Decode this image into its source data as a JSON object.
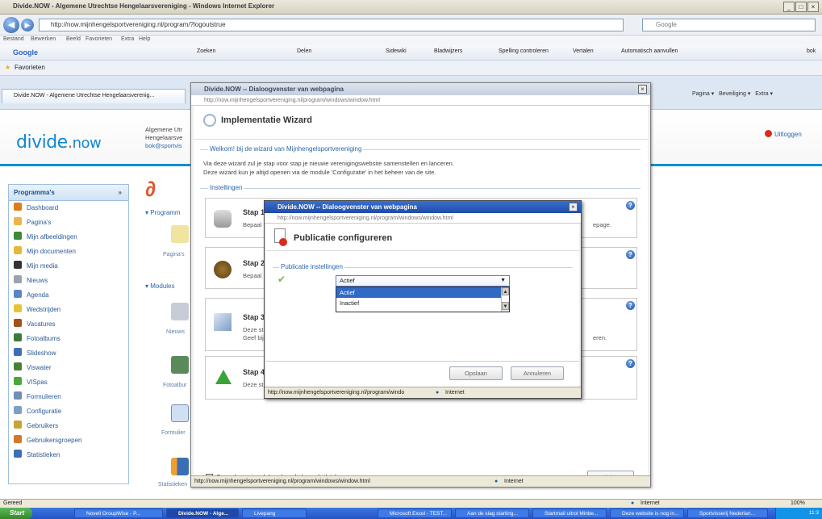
{
  "browser": {
    "title": "Divide.NOW - Algemene Utrechtse Hengelaarsvereniging - Windows Internet Explorer",
    "url": "http://now.mijnhengelsportvereniging.nl/program/?logoutstrue",
    "search_placeholder": "Google",
    "menu": [
      "Bestand",
      "Bewerken",
      "Beeld",
      "Favorieten",
      "Extra",
      "Help"
    ],
    "toolbar": [
      "Google",
      "Zoeken",
      "Delen",
      "Sidewiki",
      "Bladwijzers",
      "Spelling controleren",
      "Vertalen",
      "Automatisch aanvullen",
      "bok"
    ],
    "favorites_label": "Favorieten",
    "tab_label": "Divide.NOW - Algemene Utrechtse Hengelaarsverenig...",
    "command_bar": [
      "Pagina",
      "Beveiliging",
      "Extra"
    ],
    "status_left": "Gereed",
    "status_zone": "Internet",
    "status_zoom": "100%"
  },
  "site": {
    "logo_main": "divide",
    "logo_dot": ".",
    "logo_now": "now",
    "org_line1": "Algemene Utr",
    "org_line2": "Hengelaarsve",
    "org_line3": "bok@sportvis",
    "logout": "Uitloggen"
  },
  "sidebar": {
    "title": "Programma's",
    "items": [
      {
        "label": "Dashboard",
        "color": "#e07b1a"
      },
      {
        "label": "Pagina's",
        "color": "#e8b64a"
      },
      {
        "label": "Mijn afbeeldingen",
        "color": "#3d8a3a"
      },
      {
        "label": "Mijn documenten",
        "color": "#e5b83c"
      },
      {
        "label": "Mijn media",
        "color": "#333333"
      },
      {
        "label": "Nieuws",
        "color": "#9aa3b0"
      },
      {
        "label": "Agenda",
        "color": "#5c85c5"
      },
      {
        "label": "Wedstrijden",
        "color": "#e7c33b"
      },
      {
        "label": "Vacatures",
        "color": "#a0521d"
      },
      {
        "label": "Fotoalbums",
        "color": "#3d7a3a"
      },
      {
        "label": "Slideshow",
        "color": "#3a6fb5"
      },
      {
        "label": "Viswater",
        "color": "#4a7f3a"
      },
      {
        "label": "VISpas",
        "color": "#4aa83a"
      },
      {
        "label": "Formulieren",
        "color": "#6f8fb5"
      },
      {
        "label": "Configuratie",
        "color": "#7aa0c8"
      },
      {
        "label": "Gebruikers",
        "color": "#c8a23a"
      },
      {
        "label": "Gebruikersgroepen",
        "color": "#d2782a"
      },
      {
        "label": "Statistieken",
        "color": "#3a6fb5"
      }
    ]
  },
  "main": {
    "programs_header": "Programm",
    "modules_header": "Modules",
    "module_labels": [
      "Pagina's",
      "Nieuws",
      "Fotoalbur",
      "Formulier",
      "Statistieken"
    ]
  },
  "wizard": {
    "window_title": "Divide.NOW -- Dialoogvenster van webpagina",
    "url": "http://now.mijnhengelsportvereniging.nl/program/windows/window.html",
    "title": "Implementatie Wizard",
    "welcome_legend": "Welkom!  bij de wizard van Mijnhengelsportvereniging",
    "intro1": "Via deze wizard zul je stap voor stap je nieuwe verenigingswebsite samenstellen en lanceren.",
    "intro2": "Deze wizard kun je altijd openen via de module 'Configuratie' in het beheer van de site.",
    "settings_legend": "Instellingen",
    "steps": [
      {
        "title": "Stap 1",
        "desc": "Bepaal",
        "tail": "epage."
      },
      {
        "title": "Stap 2",
        "desc": "Bepaal",
        "tail": ""
      },
      {
        "title": "Stap 3",
        "desc": "Deze st",
        "desc2": "Geef bij",
        "tail": "eren."
      },
      {
        "title": "Stap 4",
        "desc": "Deze st",
        "tail": ""
      }
    ],
    "checkbox_label": "Open deze wizard de volgende keer als ik inlog",
    "close_button": "Sluiten",
    "status_url": "http://now.mijnhengelsportvereniging.nl/program/windows/window.html",
    "status_zone": "Internet"
  },
  "publish": {
    "window_title": "Divide.NOW -- Dialoogvenster van webpagina",
    "url": "http://now.mijnhengelsportvereniging.nl/program/windows/window.html",
    "title": "Publicatie configureren",
    "legend": "Publicatie instellingen",
    "selected": "Actief",
    "options": [
      "Actief",
      "Inactief"
    ],
    "save_button": "Opslaan",
    "cancel_button": "Annuleren",
    "status_url": "http://now.mijnhengelsportvereniging.nl/program/windo",
    "status_zone": "Internet"
  },
  "taskbar": {
    "start": "Start",
    "items": [
      "Novell GroupWise - P...",
      "Divide.NOW - Alge...",
      "Livepang",
      "Microsoft Excel - TEST...",
      "Aan de slag starting...",
      "Startmail uitrol Minbe...",
      "Deze website is nog in...",
      "Sportvisserij Nederlan..."
    ],
    "clock": "11:3"
  }
}
